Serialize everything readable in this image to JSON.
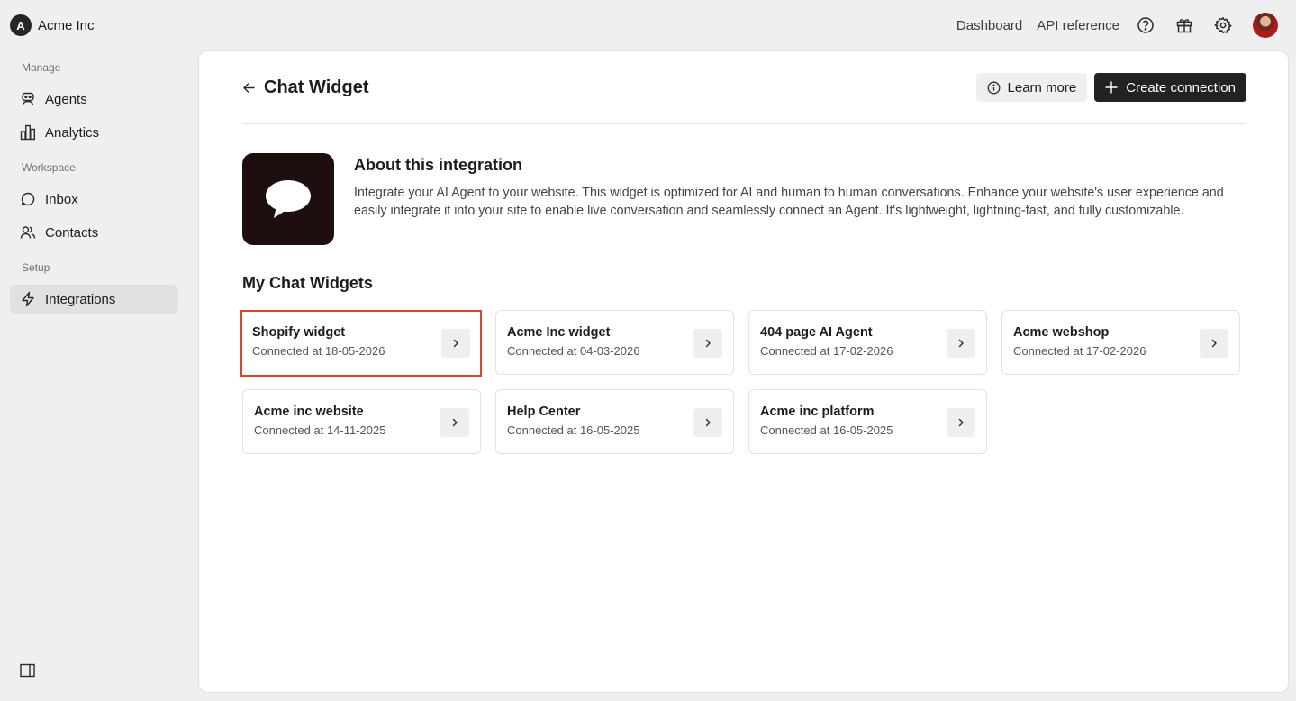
{
  "brand": {
    "logo_letter": "A",
    "name": "Acme Inc"
  },
  "topnav": {
    "dashboard": "Dashboard",
    "api_reference": "API reference",
    "icons": [
      "help-icon",
      "gift-icon",
      "settings-icon"
    ]
  },
  "sidebar": {
    "sections": [
      {
        "label": "Manage",
        "items": [
          {
            "label": "Agents",
            "icon": "robot-icon"
          },
          {
            "label": "Analytics",
            "icon": "bar-chart-icon"
          }
        ]
      },
      {
        "label": "Workspace",
        "items": [
          {
            "label": "Inbox",
            "icon": "chat-bubble-icon"
          },
          {
            "label": "Contacts",
            "icon": "users-icon"
          }
        ]
      },
      {
        "label": "Setup",
        "items": [
          {
            "label": "Integrations",
            "icon": "lightning-icon",
            "active": true
          }
        ]
      }
    ]
  },
  "page": {
    "title": "Chat Widget",
    "learn_more": "Learn more",
    "create_connection": "Create connection"
  },
  "about": {
    "title": "About this integration",
    "description": "Integrate your AI Agent to your website. This widget is optimized for AI and human to human conversations. Enhance your website's user experience and easily integrate it into your site to enable live conversation and seamlessly connect an Agent. It's lightweight, lightning-fast, and fully customizable."
  },
  "widgets": {
    "title": "My Chat Widgets",
    "items": [
      {
        "name": "Shopify widget",
        "connected": "Connected at 18-05-2026",
        "selected": true
      },
      {
        "name": "Acme Inc widget",
        "connected": "Connected at 04-03-2026"
      },
      {
        "name": "404 page AI Agent",
        "connected": "Connected at 17-02-2026"
      },
      {
        "name": "Acme webshop",
        "connected": "Connected at 17-02-2026"
      },
      {
        "name": "Acme inc website",
        "connected": "Connected at 14-11-2025"
      },
      {
        "name": "Help Center",
        "connected": "Connected at 16-05-2025"
      },
      {
        "name": "Acme inc platform",
        "connected": "Connected at 16-05-2025"
      }
    ]
  },
  "colors": {
    "background": "#efefef",
    "panel": "#ffffff",
    "primary_button": "#222222",
    "selected_border": "#d2452f",
    "about_icon_bg": "#1e0e0d"
  }
}
